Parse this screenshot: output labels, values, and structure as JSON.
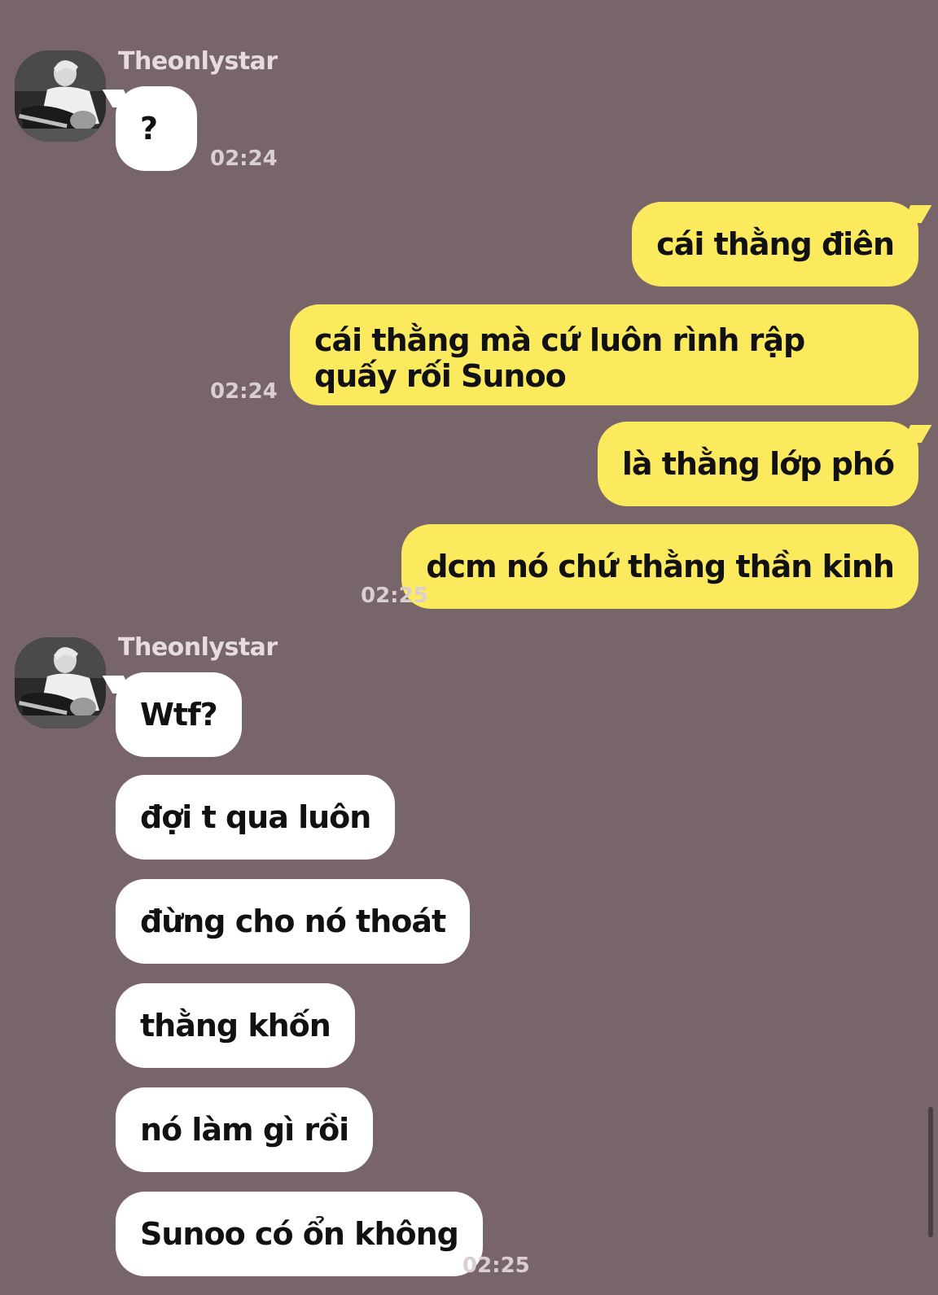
{
  "contact": {
    "name": "Theonlystar"
  },
  "messages": [
    {
      "text": "?",
      "time": "02:24"
    },
    {
      "text": "cái thằng điên"
    },
    {
      "text": "cái thằng mà cứ luôn rình rập quấy rối Sunoo",
      "time": "02:24"
    },
    {
      "text": "là thằng lớp phó"
    },
    {
      "text": "dcm nó chứ thằng thần kinh",
      "time": "02:25"
    },
    {
      "text": "Wtf?"
    },
    {
      "text": "đợi t qua luôn"
    },
    {
      "text": "đừng cho nó thoát"
    },
    {
      "text": "thằng khốn"
    },
    {
      "text": "nó làm gì rồi"
    },
    {
      "text": "Sunoo có ổn không",
      "time": "02:25"
    }
  ],
  "colors": {
    "background": "#776569",
    "incoming_bubble": "#ffffff",
    "outgoing_bubble": "#fbe95e"
  },
  "icons": {
    "avatar": "profile-photo-guitar"
  }
}
